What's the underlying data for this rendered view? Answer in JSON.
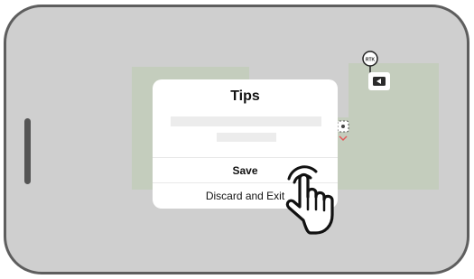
{
  "dialog": {
    "title": "Tips",
    "save_label": "Save",
    "discard_label": "Discard and Exit"
  },
  "map": {
    "rtk_label": "RTK"
  },
  "colors": {
    "screen_background": "#cfcfcf",
    "field": "#c4cdbd",
    "frame": "#5e5e5e",
    "dialog_background": "#ffffff",
    "mower_arrow": "#e35a5a"
  },
  "icons": [
    "rtk-station-icon",
    "charging-dock-icon",
    "mower-icon",
    "hand-pointer-icon"
  ]
}
